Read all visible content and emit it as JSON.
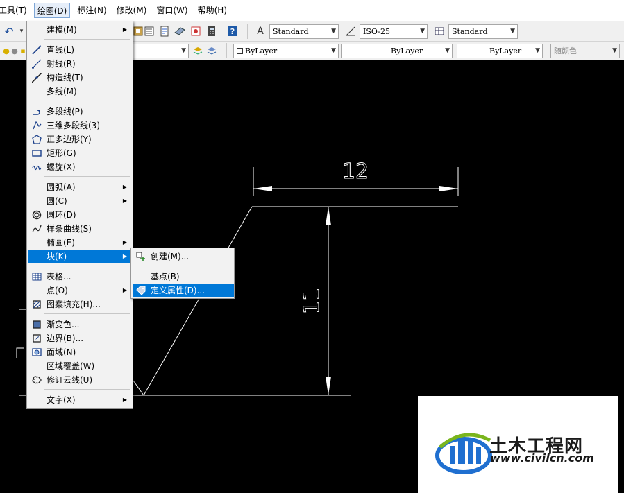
{
  "menubar": {
    "items": [
      "工具(T)",
      "绘图(D)",
      "标注(N)",
      "修改(M)",
      "窗口(W)",
      "帮助(H)"
    ]
  },
  "toolbar": {
    "text_style": "Standard",
    "dim_style": "ISO-25",
    "table_style": "Standard",
    "color": "ByLayer",
    "linetype": "ByLayer",
    "lineweight": "ByLayer",
    "plot_style": "随颜色"
  },
  "draw_menu": {
    "items": [
      {
        "label": "建模(M)",
        "icon": "none",
        "submenu": true
      },
      {
        "label": "直线(L)",
        "icon": "line-icon"
      },
      {
        "label": "射线(R)",
        "icon": "ray-icon"
      },
      {
        "label": "构造线(T)",
        "icon": "xline-icon"
      },
      {
        "label": "多线(M)",
        "icon": "none"
      },
      {
        "label": "多段线(P)",
        "icon": "polyline-icon"
      },
      {
        "label": "三维多段线(3)",
        "icon": "3dpolyline-icon"
      },
      {
        "label": "正多边形(Y)",
        "icon": "polygon-icon"
      },
      {
        "label": "矩形(G)",
        "icon": "rectangle-icon"
      },
      {
        "label": "螺旋(X)",
        "icon": "helix-icon"
      },
      {
        "label": "圆弧(A)",
        "icon": "none",
        "submenu": true
      },
      {
        "label": "圆(C)",
        "icon": "none",
        "submenu": true
      },
      {
        "label": "圆环(D)",
        "icon": "donut-icon"
      },
      {
        "label": "样条曲线(S)",
        "icon": "spline-icon"
      },
      {
        "label": "椭圆(E)",
        "icon": "none",
        "submenu": true
      },
      {
        "label": "块(K)",
        "icon": "none",
        "submenu": true
      },
      {
        "label": "表格...",
        "icon": "table-icon"
      },
      {
        "label": "点(O)",
        "icon": "none",
        "submenu": true
      },
      {
        "label": "图案填充(H)...",
        "icon": "hatch-icon"
      },
      {
        "label": "渐变色...",
        "icon": "gradient-icon"
      },
      {
        "label": "边界(B)...",
        "icon": "boundary-icon"
      },
      {
        "label": "面域(N)",
        "icon": "region-icon"
      },
      {
        "label": "区域覆盖(W)",
        "icon": "none"
      },
      {
        "label": "修订云线(U)",
        "icon": "revcloud-icon"
      },
      {
        "label": "文字(X)",
        "icon": "none",
        "submenu": true
      }
    ]
  },
  "block_submenu": {
    "items": [
      {
        "label": "创建(M)...",
        "icon": "block-create-icon"
      },
      {
        "label": "基点(B)",
        "icon": "none"
      },
      {
        "label": "定义属性(D)...",
        "icon": "attribute-icon"
      }
    ]
  },
  "drawing": {
    "dim_horizontal": "12",
    "dim_vertical": "11"
  },
  "watermark": {
    "brand": "土木工程网",
    "url": "www.civilcn.com"
  },
  "colors": {
    "highlight": "#0078d7",
    "canvas": "#000000",
    "logo_blue": "#1f6fd0",
    "logo_green": "#7ab51d"
  }
}
